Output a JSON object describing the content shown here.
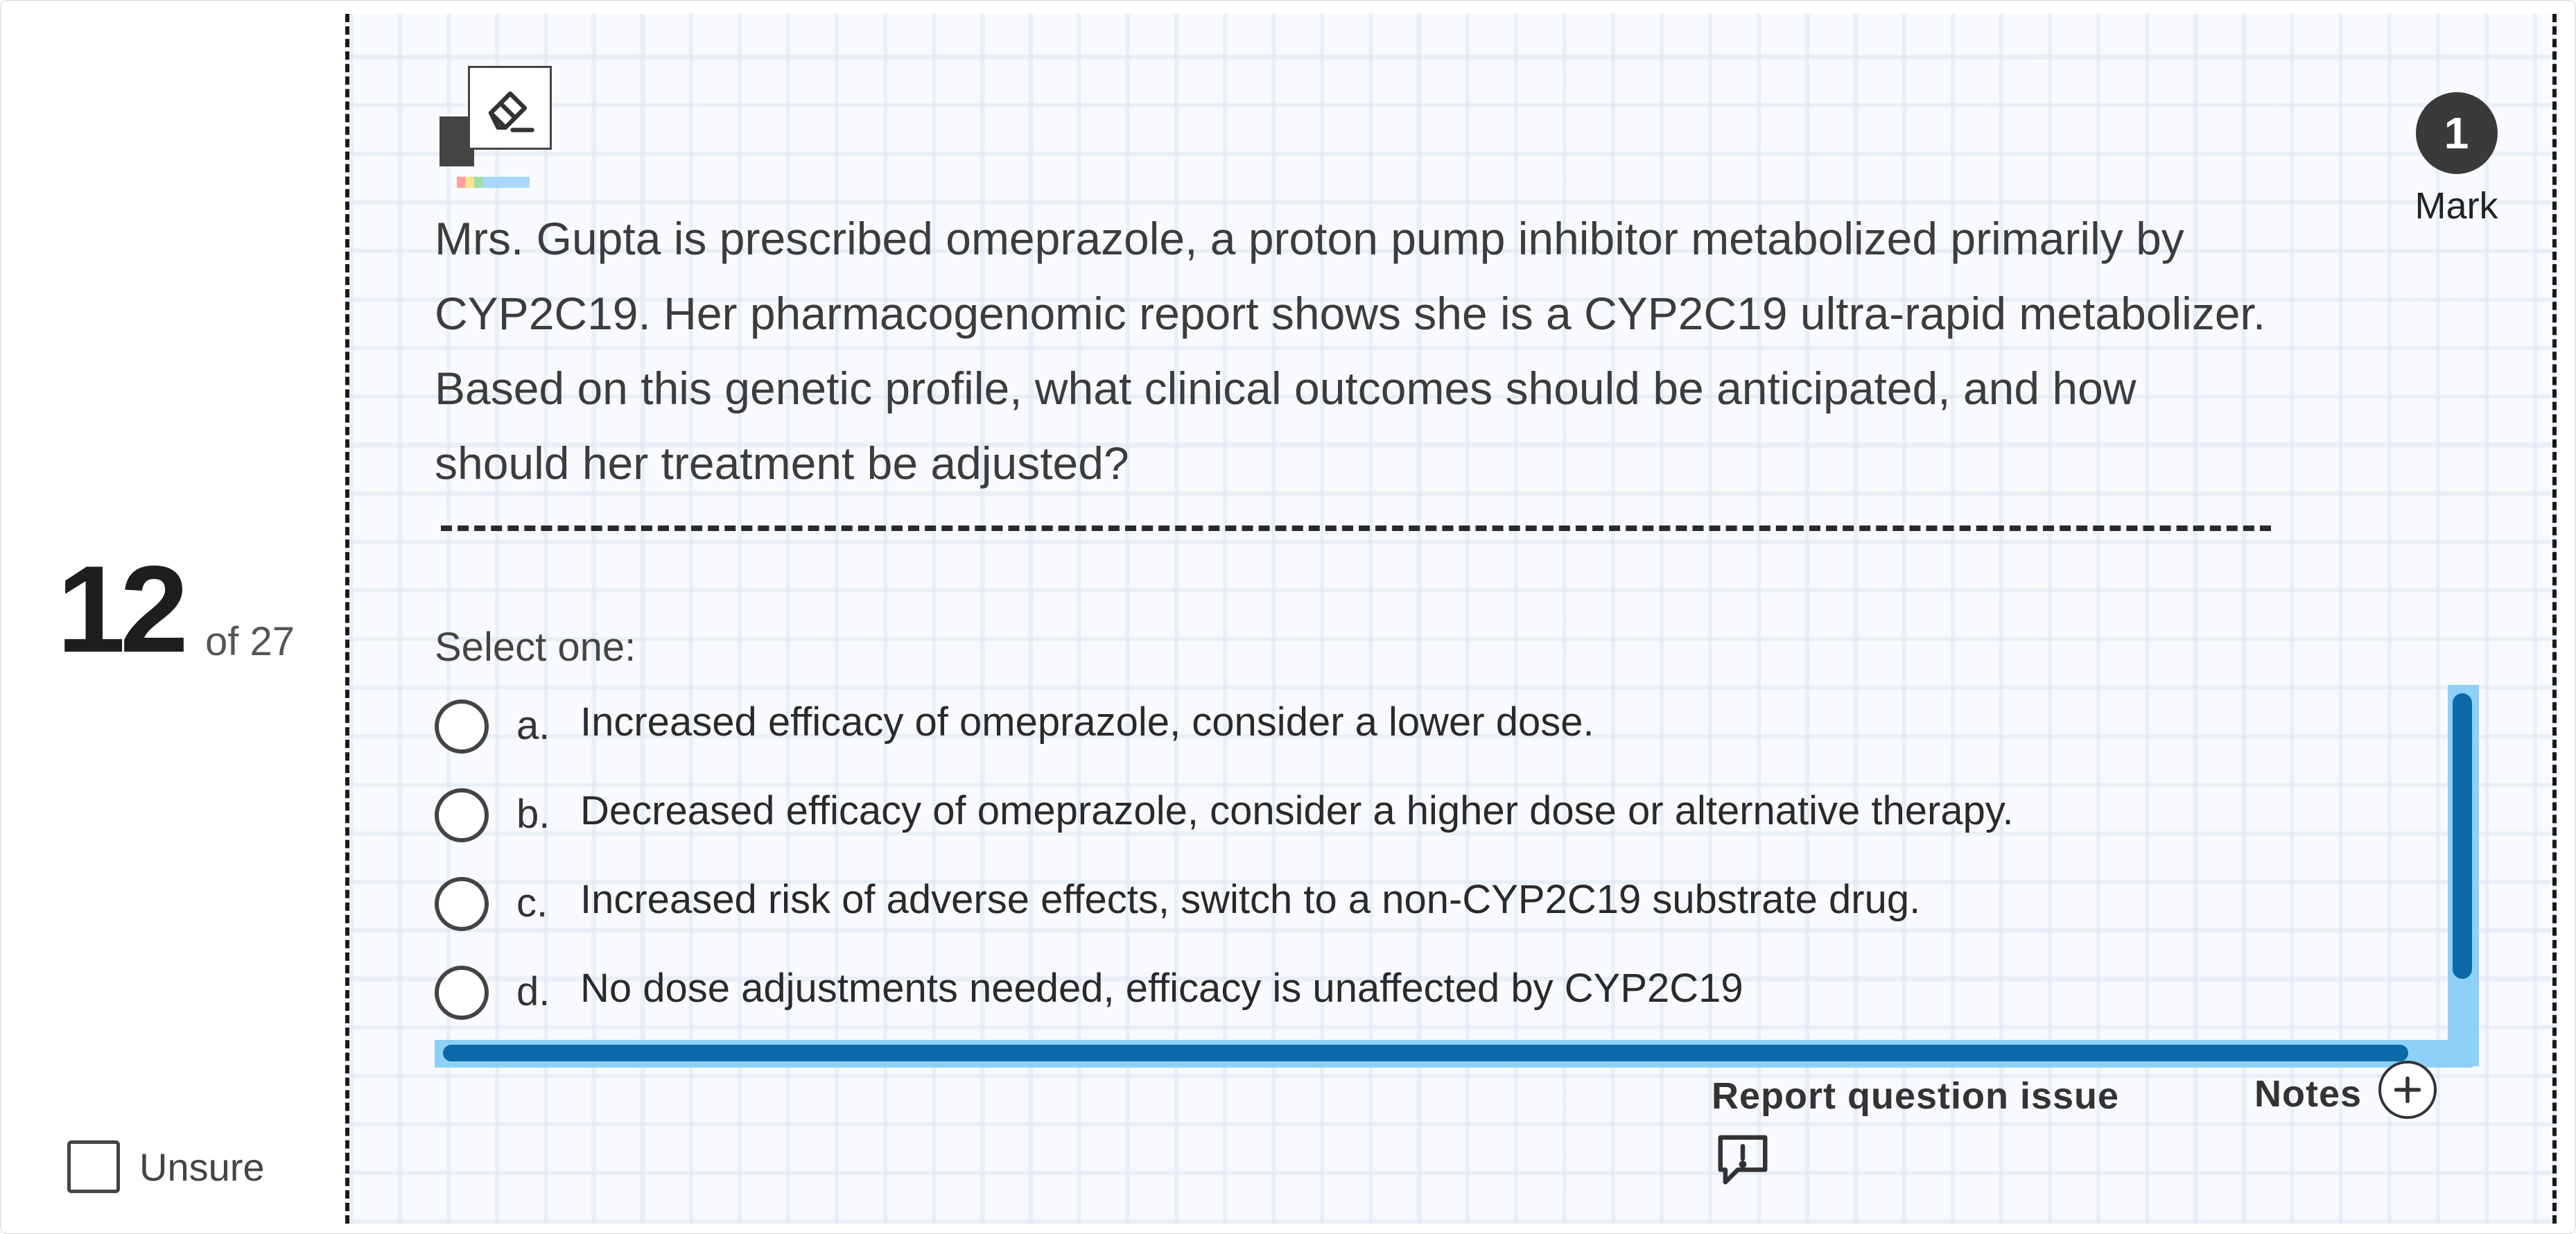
{
  "sidebar": {
    "question_number": "12",
    "of_total": "of 27",
    "unsure_label": "Unsure"
  },
  "mark": {
    "count": "1",
    "label": "Mark"
  },
  "question": {
    "text": "Mrs. Gupta is prescribed omeprazole, a proton pump inhibitor metabolized primarily by CYP2C19. Her pharmacogenomic report shows she is a CYP2C19 ultra-rapid metabolizer. Based on this genetic profile, what clinical outcomes should be anticipated, and how should her treatment be adjusted?",
    "select_prompt": "Select one:"
  },
  "options": [
    {
      "letter": "a.",
      "text": "Increased efficacy of omeprazole, consider a lower dose."
    },
    {
      "letter": "b.",
      "text": "Decreased efficacy of omeprazole, consider a higher dose or alternative therapy."
    },
    {
      "letter": "c.",
      "text": "Increased risk of adverse effects, switch to a non-CYP2C19 substrate drug."
    },
    {
      "letter": "d.",
      "text": "No dose adjustments needed, efficacy is unaffected by CYP2C19"
    }
  ],
  "footer": {
    "report_label": "Report question issue",
    "notes_label": "Notes"
  },
  "icons": {
    "eraser": "eraser-icon",
    "report": "comment-exclamation-icon",
    "notes": "plus-circle-icon"
  },
  "colors": {
    "scroll_thumb": "#0d6aa8",
    "scroll_track": "#8ed0f6",
    "mark_badge": "#3a3a3a"
  }
}
